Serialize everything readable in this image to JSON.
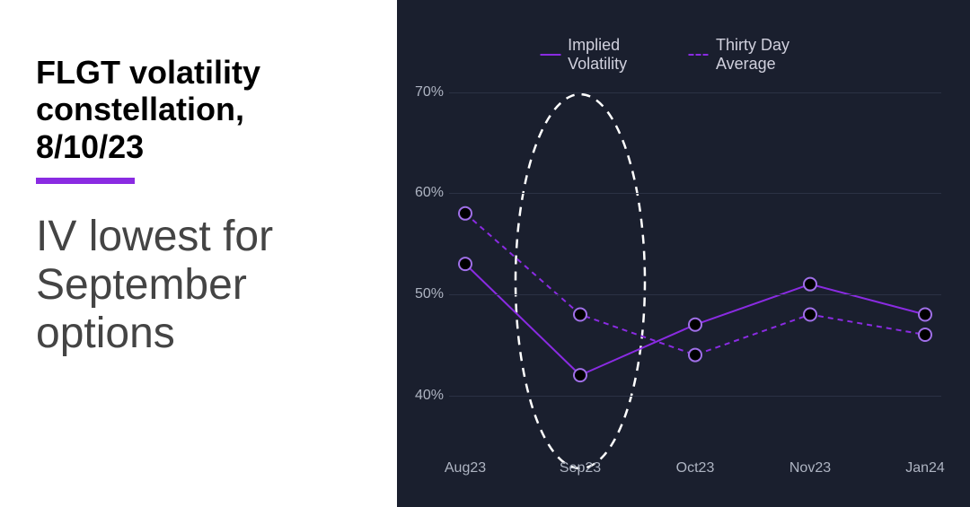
{
  "left": {
    "title": "FLGT volatility constellation, 8/10/23",
    "subtitle": "IV lowest for September options"
  },
  "legend": {
    "series_a": "Implied Volatility",
    "series_b": "Thirty Day Average"
  },
  "y_ticks": [
    "70%",
    "60%",
    "50%",
    "40%"
  ],
  "x_ticks": [
    "Aug23",
    "Sep23",
    "Oct23",
    "Nov23",
    "Jan24"
  ],
  "chart_data": {
    "type": "line",
    "categories": [
      "Aug23",
      "Sep23",
      "Oct23",
      "Nov23",
      "Jan24"
    ],
    "series": [
      {
        "name": "Implied Volatility",
        "values": [
          53,
          42,
          47,
          51,
          48
        ]
      },
      {
        "name": "Thirty Day Average",
        "values": [
          58,
          48,
          44,
          48,
          46
        ]
      }
    ],
    "title": "FLGT volatility constellation, 8/10/23",
    "xlabel": "",
    "ylabel": "",
    "ylim": [
      35,
      72
    ],
    "y_ticks": [
      70,
      60,
      50,
      40
    ],
    "highlight_category": "Sep23"
  }
}
